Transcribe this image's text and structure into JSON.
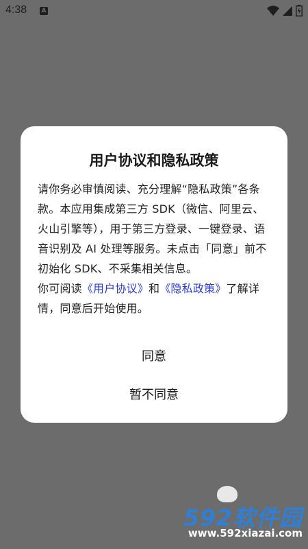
{
  "status_bar": {
    "time": "4:38",
    "notification_letter": "A",
    "icons": [
      "wifi-icon",
      "signal-icon",
      "battery-icon"
    ]
  },
  "dialog": {
    "title": "用户协议和隐私政策",
    "paragraph1": "请你务必审慎阅读、充分理解“隐私政策”各条款。本应用集成第三方 SDK（微信、阿里云、火山引擎等），用于第三方登录、一键登录、语音识别及 AI 处理等服务。未点击「同意」前不初始化 SDK、不采集相关信息。",
    "paragraph2_prefix": "你可阅读",
    "user_agreement_link": "《用户协议》",
    "and_text": "和",
    "privacy_policy_link": "《隐私政策》",
    "paragraph2_suffix": "了解详情，同意后开始使用。",
    "agree_label": "同意",
    "disagree_label": "暂不同意",
    "link_color": "#2b3ccf"
  },
  "watermark": {
    "brand": "592软件园",
    "url": "www.592xiazai.com"
  }
}
